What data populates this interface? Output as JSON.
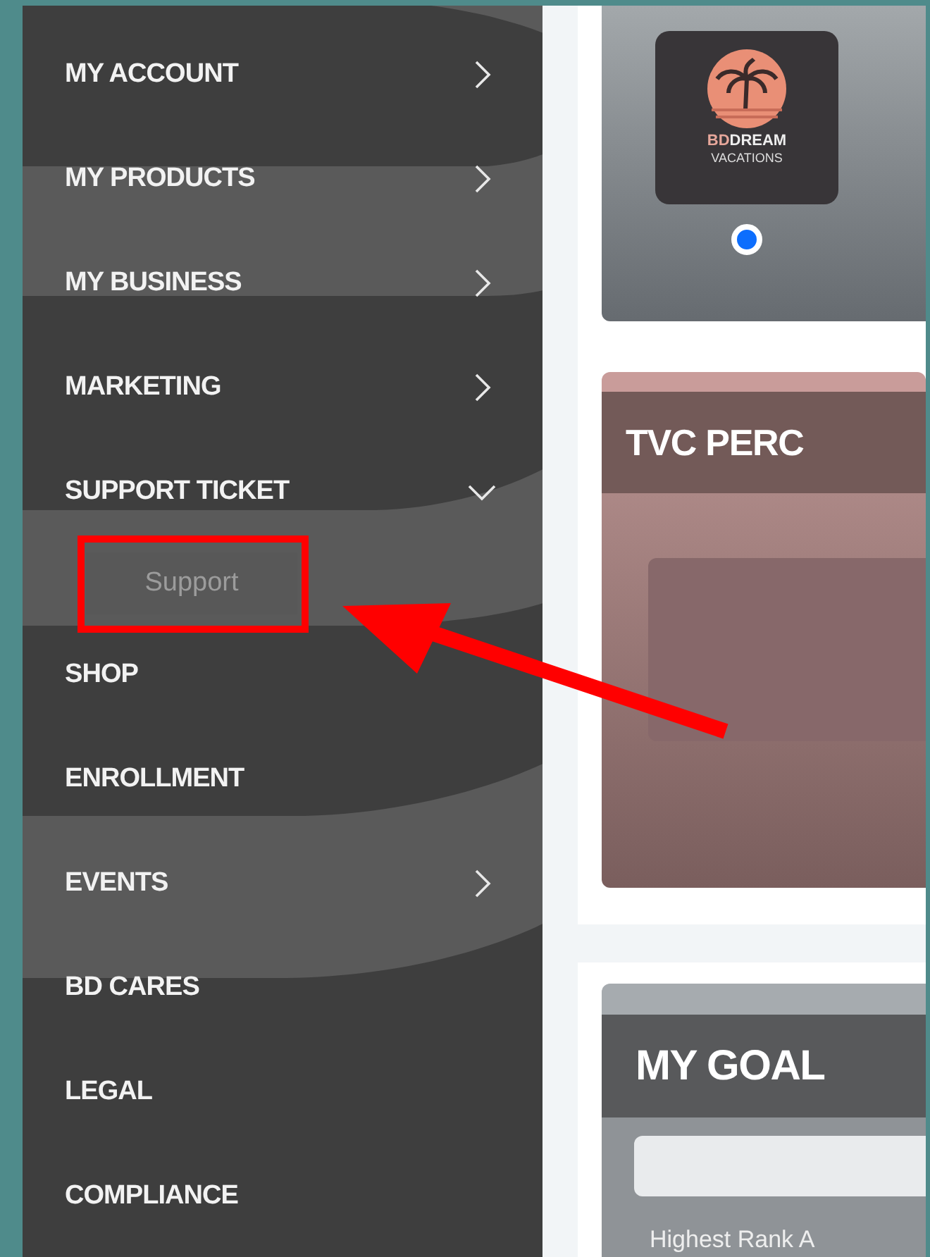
{
  "sidebar": {
    "items": [
      {
        "label": "MY ACCOUNT",
        "kind": "group",
        "expanded": false
      },
      {
        "label": "MY PRODUCTS",
        "kind": "group",
        "expanded": false
      },
      {
        "label": "MY BUSINESS",
        "kind": "group",
        "expanded": false
      },
      {
        "label": "MARKETING",
        "kind": "group",
        "expanded": false
      },
      {
        "label": "SUPPORT TICKET",
        "kind": "group",
        "expanded": true,
        "children": [
          {
            "label": "Support"
          }
        ]
      },
      {
        "label": "SHOP",
        "kind": "link"
      },
      {
        "label": "ENROLLMENT",
        "kind": "link"
      },
      {
        "label": "EVENTS",
        "kind": "group",
        "expanded": false
      },
      {
        "label": "BD CARES",
        "kind": "link"
      },
      {
        "label": "LEGAL",
        "kind": "link"
      },
      {
        "label": "COMPLIANCE",
        "kind": "link"
      }
    ]
  },
  "brand_card": {
    "logo": {
      "brand": "BD",
      "name": "DREAM",
      "tagline": "VACATIONS"
    },
    "radio": {
      "selected": true
    }
  },
  "tvc_card": {
    "title": "TVC PERC"
  },
  "goal_card": {
    "title": "MY GOAL",
    "caption": "Highest Rank A"
  }
}
